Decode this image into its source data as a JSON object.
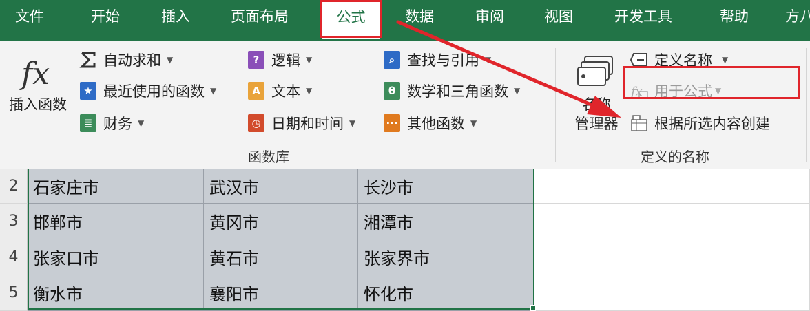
{
  "tabs": [
    {
      "label": "文件"
    },
    {
      "label": "开始"
    },
    {
      "label": "插入"
    },
    {
      "label": "页面布局"
    },
    {
      "label": "公式",
      "active": true
    },
    {
      "label": "数据"
    },
    {
      "label": "审阅"
    },
    {
      "label": "视图"
    },
    {
      "label": "开发工具"
    },
    {
      "label": "帮助"
    },
    {
      "label": "方八"
    }
  ],
  "function_library": {
    "insert_function_label": "插入函数",
    "group_label": "函数库",
    "autosum": "自动求和",
    "recent": "最近使用的函数",
    "financial": "财务",
    "logical": "逻辑",
    "text": "文本",
    "datetime": "日期和时间",
    "lookup": "查找与引用",
    "math": "数学和三角函数",
    "other": "其他函数"
  },
  "defined_names": {
    "name_manager_line1": "名称",
    "name_manager_line2": "管理器",
    "define_name": "定义名称",
    "use_in_formula": "用于公式",
    "create_from_selection": "根据所选内容创建",
    "group_label": "定义的名称"
  },
  "colors": {
    "ribbon_green": "#227447",
    "highlight_red": "#e0252b",
    "selection_fill": "#c8cdd3"
  },
  "sheet": {
    "rows": [
      {
        "num": "2",
        "cells": [
          "石家庄市",
          "武汉市",
          "长沙市"
        ]
      },
      {
        "num": "3",
        "cells": [
          "邯郸市",
          "黄冈市",
          "湘潭市"
        ]
      },
      {
        "num": "4",
        "cells": [
          "张家口市",
          "黄石市",
          "张家界市"
        ]
      },
      {
        "num": "5",
        "cells": [
          "衡水市",
          "襄阳市",
          "怀化市"
        ]
      }
    ]
  }
}
